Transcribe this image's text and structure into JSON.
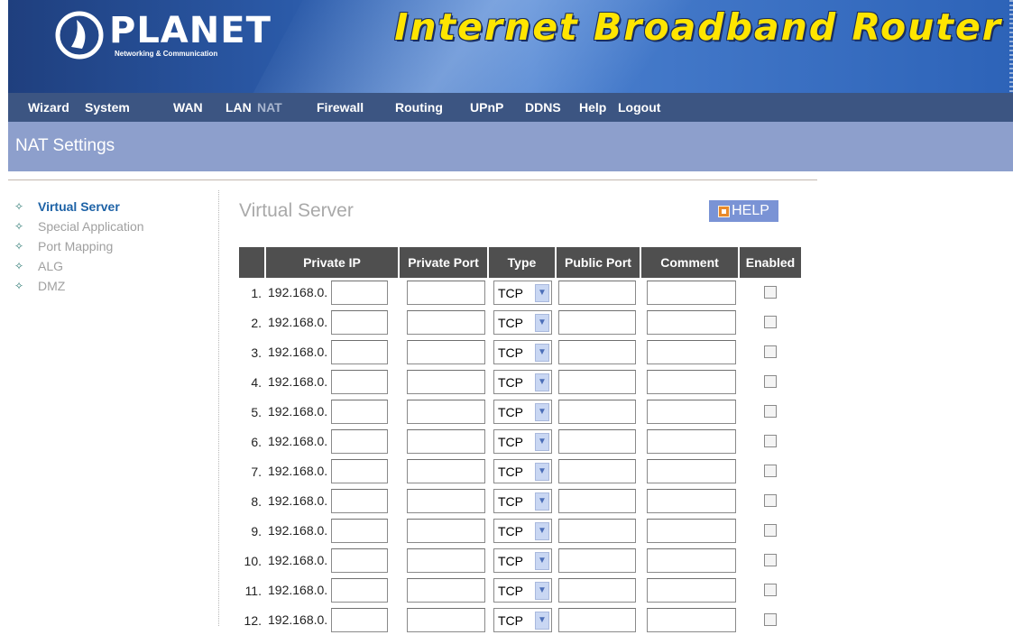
{
  "banner": {
    "brand": "PLANET",
    "brand_sub": "Networking & Communication",
    "title": "Internet Broadband Router"
  },
  "nav": {
    "items": [
      {
        "label": "Wizard"
      },
      {
        "label": "System"
      },
      {
        "label": "WAN"
      },
      {
        "label": "LAN"
      },
      {
        "label": "NAT"
      },
      {
        "label": "Firewall"
      },
      {
        "label": "Routing"
      },
      {
        "label": "UPnP"
      },
      {
        "label": "DDNS"
      },
      {
        "label": "Help"
      },
      {
        "label": "Logout"
      }
    ],
    "active": "NAT"
  },
  "section": {
    "title": "NAT Settings"
  },
  "sidebar": {
    "items": [
      {
        "label": "Virtual Server"
      },
      {
        "label": "Special Application"
      },
      {
        "label": "Port Mapping"
      },
      {
        "label": "ALG"
      },
      {
        "label": "DMZ"
      }
    ],
    "active": "Virtual Server"
  },
  "main": {
    "title": "Virtual Server",
    "help_label": "HELP"
  },
  "table": {
    "headers": {
      "private_ip": "Private IP",
      "private_port": "Private Port",
      "type": "Type",
      "public_port": "Public Port",
      "comment": "Comment",
      "enabled": "Enabled"
    },
    "ip_prefix": "192.168.0.",
    "type_value": "TCP",
    "rows": [
      {
        "index": "1."
      },
      {
        "index": "2."
      },
      {
        "index": "3."
      },
      {
        "index": "4."
      },
      {
        "index": "5."
      },
      {
        "index": "6."
      },
      {
        "index": "7."
      },
      {
        "index": "8."
      },
      {
        "index": "9."
      },
      {
        "index": "10."
      },
      {
        "index": "11."
      },
      {
        "index": "12."
      }
    ]
  },
  "colors": {
    "banner_title": "#ffe500",
    "nav_bg": "#3c5582",
    "section_bg": "#8d9fcc",
    "header_bg": "#4f4f4f",
    "active_link": "#1d62a6"
  }
}
